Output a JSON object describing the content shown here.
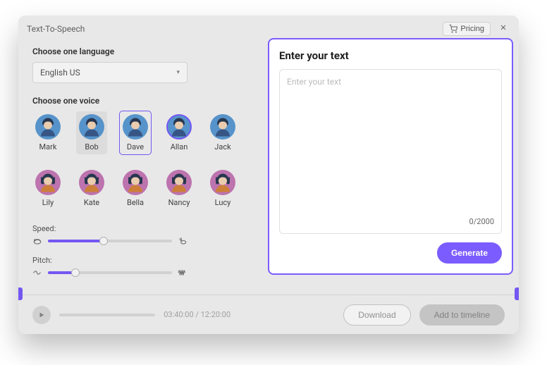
{
  "header": {
    "title": "Text-To-Speech",
    "pricing_label": "Pricing"
  },
  "language": {
    "label": "Choose one language",
    "selected": "English US"
  },
  "voice_section": {
    "label": "Choose one voice",
    "voices": [
      {
        "name": "Mark",
        "gender": "male",
        "state": ""
      },
      {
        "name": "Bob",
        "gender": "male",
        "state": "hovered"
      },
      {
        "name": "Dave",
        "gender": "male",
        "state": "selected"
      },
      {
        "name": "Allan",
        "gender": "male",
        "state": "playing"
      },
      {
        "name": "Jack",
        "gender": "male",
        "state": ""
      },
      {
        "name": "Lily",
        "gender": "female",
        "state": ""
      },
      {
        "name": "Kate",
        "gender": "female",
        "state": ""
      },
      {
        "name": "Bella",
        "gender": "female",
        "state": ""
      },
      {
        "name": "Nancy",
        "gender": "female",
        "state": ""
      },
      {
        "name": "Lucy",
        "gender": "female",
        "state": ""
      }
    ]
  },
  "sliders": {
    "speed": {
      "label": "Speed:",
      "value": 45
    },
    "pitch": {
      "label": "Pitch:",
      "value": 22
    }
  },
  "footer": {
    "time": "03:40:00 / 12:20:00",
    "download_label": "Download",
    "add_label": "Add to timeline"
  },
  "panel": {
    "title": "Enter your text",
    "placeholder": "Enter your text",
    "char_count": "0/2000",
    "generate_label": "Generate"
  }
}
